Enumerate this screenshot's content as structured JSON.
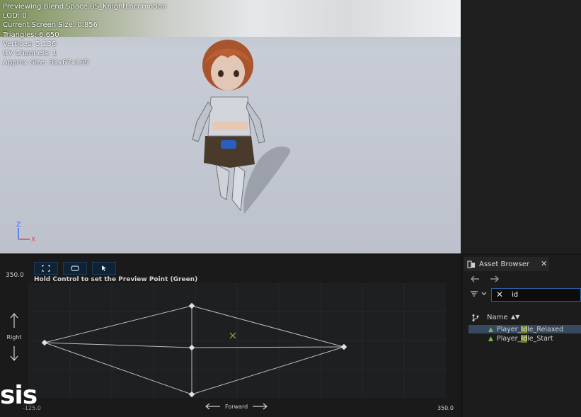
{
  "viewport": {
    "info_lines": [
      "Previewing Blend Space BS_KnightLocomotion",
      "LOD: 0",
      "Current Screen Size: 0.856",
      "Triangles: 6,650",
      "Vertices: 5,136",
      "UV Channels: 1",
      "Approx Size: 81x67x139"
    ],
    "gizmo": {
      "z": "Z",
      "x": "X"
    }
  },
  "blend_space": {
    "toolbar_icons": [
      "fit-view-icon",
      "preview-shape-icon",
      "select-cursor-icon"
    ],
    "y_max": "350.0",
    "hint": "Hold Control to set the Preview Point (Green)",
    "y_axis_label": "Right",
    "x_axis_label": "Forward",
    "x_min": "-125.0",
    "x_max": "350.0",
    "watermark": "sis"
  },
  "asset_browser": {
    "title": "Asset Browser",
    "close": "✕",
    "search_clear": "✕",
    "search_value": "id",
    "column_name": "Name",
    "sort_arrow": "▲▼",
    "rows": [
      {
        "pre": "Player_",
        "match": "Id",
        "post": "le_Relaxed",
        "selected": true
      },
      {
        "pre": "Player_",
        "match": "Id",
        "post": "le_Start",
        "selected": false
      }
    ]
  },
  "colors": {
    "accent": "#2a5d9a",
    "highlight": "#6d7f1e",
    "selection": "#36495e"
  }
}
